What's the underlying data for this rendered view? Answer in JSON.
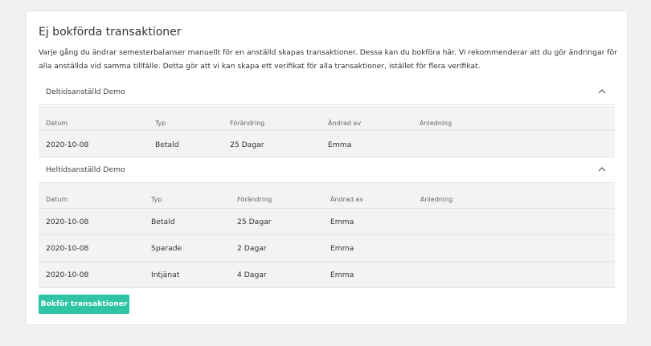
{
  "title": "Ej bokförda transaktioner",
  "description": "Varje gång du ändrar semesterbalanser manuellt för en anställd skapas transaktioner. Dessa kan du bokföra här. Vi rekommenderar att du gör ändringar för alla anställda vid samma tillfälle. Detta gör att vi kan skapa ett verifikat för alla transaktioner, istället för flera verifikat.",
  "columns": {
    "date": "Datum",
    "type": "Typ",
    "change": "Förändring",
    "changed_by": "Ändrad av",
    "reason": "Anledning"
  },
  "groups": [
    {
      "name": "Deltidsanställd Demo",
      "rows": [
        {
          "date": "2020-10-08",
          "type": "Betald",
          "change": "25 Dagar",
          "changed_by": "Emma",
          "reason": ""
        }
      ]
    },
    {
      "name": "Heltidsanställd Demo",
      "rows": [
        {
          "date": "2020-10-08",
          "type": "Betald",
          "change": "25 Dagar",
          "changed_by": "Emma",
          "reason": ""
        },
        {
          "date": "2020-10-08",
          "type": "Sparade",
          "change": "2 Dagar",
          "changed_by": "Emma",
          "reason": ""
        },
        {
          "date": "2020-10-08",
          "type": "Intjänat",
          "change": "4 Dagar",
          "changed_by": "Emma",
          "reason": ""
        }
      ]
    }
  ],
  "button_label": "Bokför transaktioner",
  "icons": {
    "collapse": "chevron-up-icon"
  },
  "colors": {
    "accent": "#2ec4a4",
    "table_bg": "#f3f3f3",
    "page_bg": "#f1f1f1"
  }
}
